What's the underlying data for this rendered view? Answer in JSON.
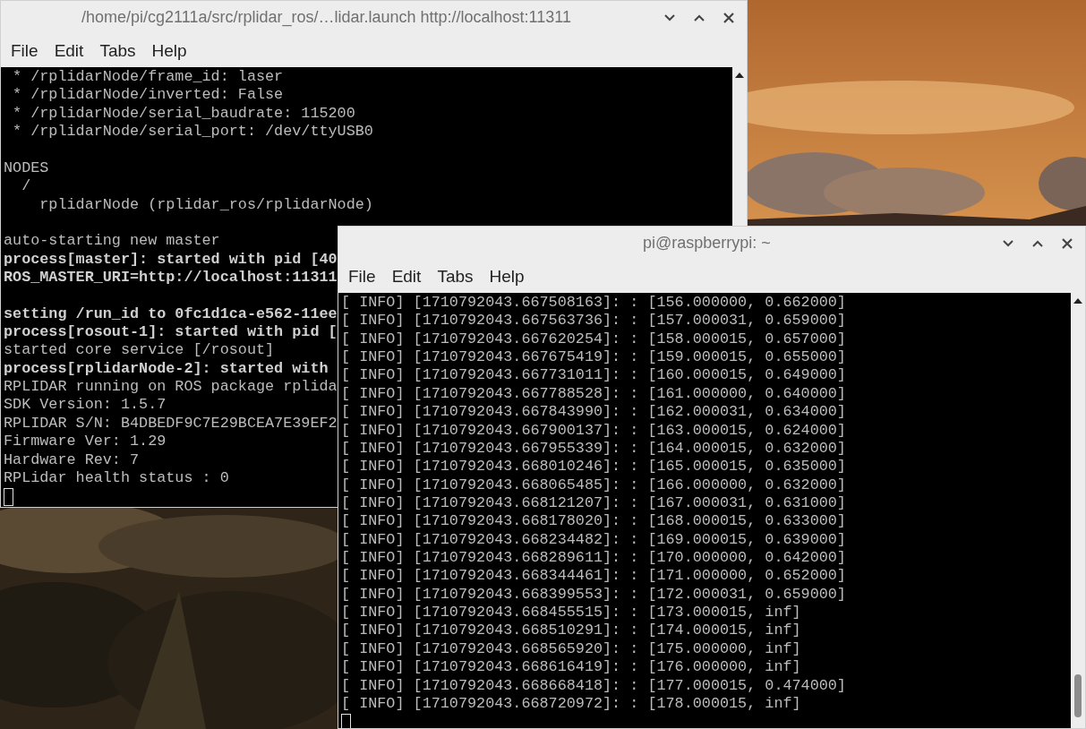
{
  "windows": [
    {
      "title": "/home/pi/cg2111a/src/rplidar_ros/…lidar.launch http://localhost:11311",
      "menu": [
        "File",
        "Edit",
        "Tabs",
        "Help"
      ],
      "lines": [
        {
          "text": " * /rplidarNode/frame_id: laser",
          "bold": false
        },
        {
          "text": " * /rplidarNode/inverted: False",
          "bold": false
        },
        {
          "text": " * /rplidarNode/serial_baudrate: 115200",
          "bold": false
        },
        {
          "text": " * /rplidarNode/serial_port: /dev/ttyUSB0",
          "bold": false
        },
        {
          "kind": "blank"
        },
        {
          "text": "NODES",
          "bold": false
        },
        {
          "text": "  /",
          "bold": false
        },
        {
          "text": "    rplidarNode (rplidar_ros/rplidarNode)",
          "bold": false
        },
        {
          "kind": "blank"
        },
        {
          "text": "auto-starting new master",
          "bold": false
        },
        {
          "text": "process[master]: started with pid [40",
          "bold": true
        },
        {
          "text": "ROS_MASTER_URI=http://localhost:11311",
          "bold": true
        },
        {
          "kind": "blank"
        },
        {
          "text": "setting /run_id to 0fc1d1ca-e562-11ee",
          "bold": true
        },
        {
          "text": "process[rosout-1]: started with pid [",
          "bold": true
        },
        {
          "text": "started core service [/rosout]",
          "bold": false
        },
        {
          "text": "process[rplidarNode-2]: started with",
          "bold": true
        },
        {
          "text": "RPLIDAR running on ROS package rplida",
          "bold": false
        },
        {
          "text": "SDK Version: 1.5.7",
          "bold": false
        },
        {
          "text": "RPLIDAR S/N: B4DBEDF9C7E29BCEA7E39EF2",
          "bold": false
        },
        {
          "text": "Firmware Ver: 1.29",
          "bold": false
        },
        {
          "text": "Hardware Rev: 7",
          "bold": false
        },
        {
          "text": "RPLidar health status : 0",
          "bold": false
        }
      ]
    },
    {
      "title": "pi@raspberrypi: ~",
      "menu": [
        "File",
        "Edit",
        "Tabs",
        "Help"
      ],
      "lines": [
        {
          "text": "[ INFO] [1710792043.667508163]: : [156.000000, 0.662000]",
          "bold": false
        },
        {
          "text": "[ INFO] [1710792043.667563736]: : [157.000031, 0.659000]",
          "bold": false
        },
        {
          "text": "[ INFO] [1710792043.667620254]: : [158.000015, 0.657000]",
          "bold": false
        },
        {
          "text": "[ INFO] [1710792043.667675419]: : [159.000015, 0.655000]",
          "bold": false
        },
        {
          "text": "[ INFO] [1710792043.667731011]: : [160.000015, 0.649000]",
          "bold": false
        },
        {
          "text": "[ INFO] [1710792043.667788528]: : [161.000000, 0.640000]",
          "bold": false
        },
        {
          "text": "[ INFO] [1710792043.667843990]: : [162.000031, 0.634000]",
          "bold": false
        },
        {
          "text": "[ INFO] [1710792043.667900137]: : [163.000015, 0.624000]",
          "bold": false
        },
        {
          "text": "[ INFO] [1710792043.667955339]: : [164.000015, 0.632000]",
          "bold": false
        },
        {
          "text": "[ INFO] [1710792043.668010246]: : [165.000015, 0.635000]",
          "bold": false
        },
        {
          "text": "[ INFO] [1710792043.668065485]: : [166.000000, 0.632000]",
          "bold": false
        },
        {
          "text": "[ INFO] [1710792043.668121207]: : [167.000031, 0.631000]",
          "bold": false
        },
        {
          "text": "[ INFO] [1710792043.668178020]: : [168.000015, 0.633000]",
          "bold": false
        },
        {
          "text": "[ INFO] [1710792043.668234482]: : [169.000015, 0.639000]",
          "bold": false
        },
        {
          "text": "[ INFO] [1710792043.668289611]: : [170.000000, 0.642000]",
          "bold": false
        },
        {
          "text": "[ INFO] [1710792043.668344461]: : [171.000000, 0.652000]",
          "bold": false
        },
        {
          "text": "[ INFO] [1710792043.668399553]: : [172.000031, 0.659000]",
          "bold": false
        },
        {
          "text": "[ INFO] [1710792043.668455515]: : [173.000015, inf]",
          "bold": false
        },
        {
          "text": "[ INFO] [1710792043.668510291]: : [174.000015, inf]",
          "bold": false
        },
        {
          "text": "[ INFO] [1710792043.668565920]: : [175.000000, inf]",
          "bold": false
        },
        {
          "text": "[ INFO] [1710792043.668616419]: : [176.000000, inf]",
          "bold": false
        },
        {
          "text": "[ INFO] [1710792043.668668418]: : [177.000015, 0.474000]",
          "bold": false
        },
        {
          "text": "[ INFO] [1710792043.668720972]: : [178.000015, inf]",
          "bold": false
        }
      ]
    }
  ]
}
